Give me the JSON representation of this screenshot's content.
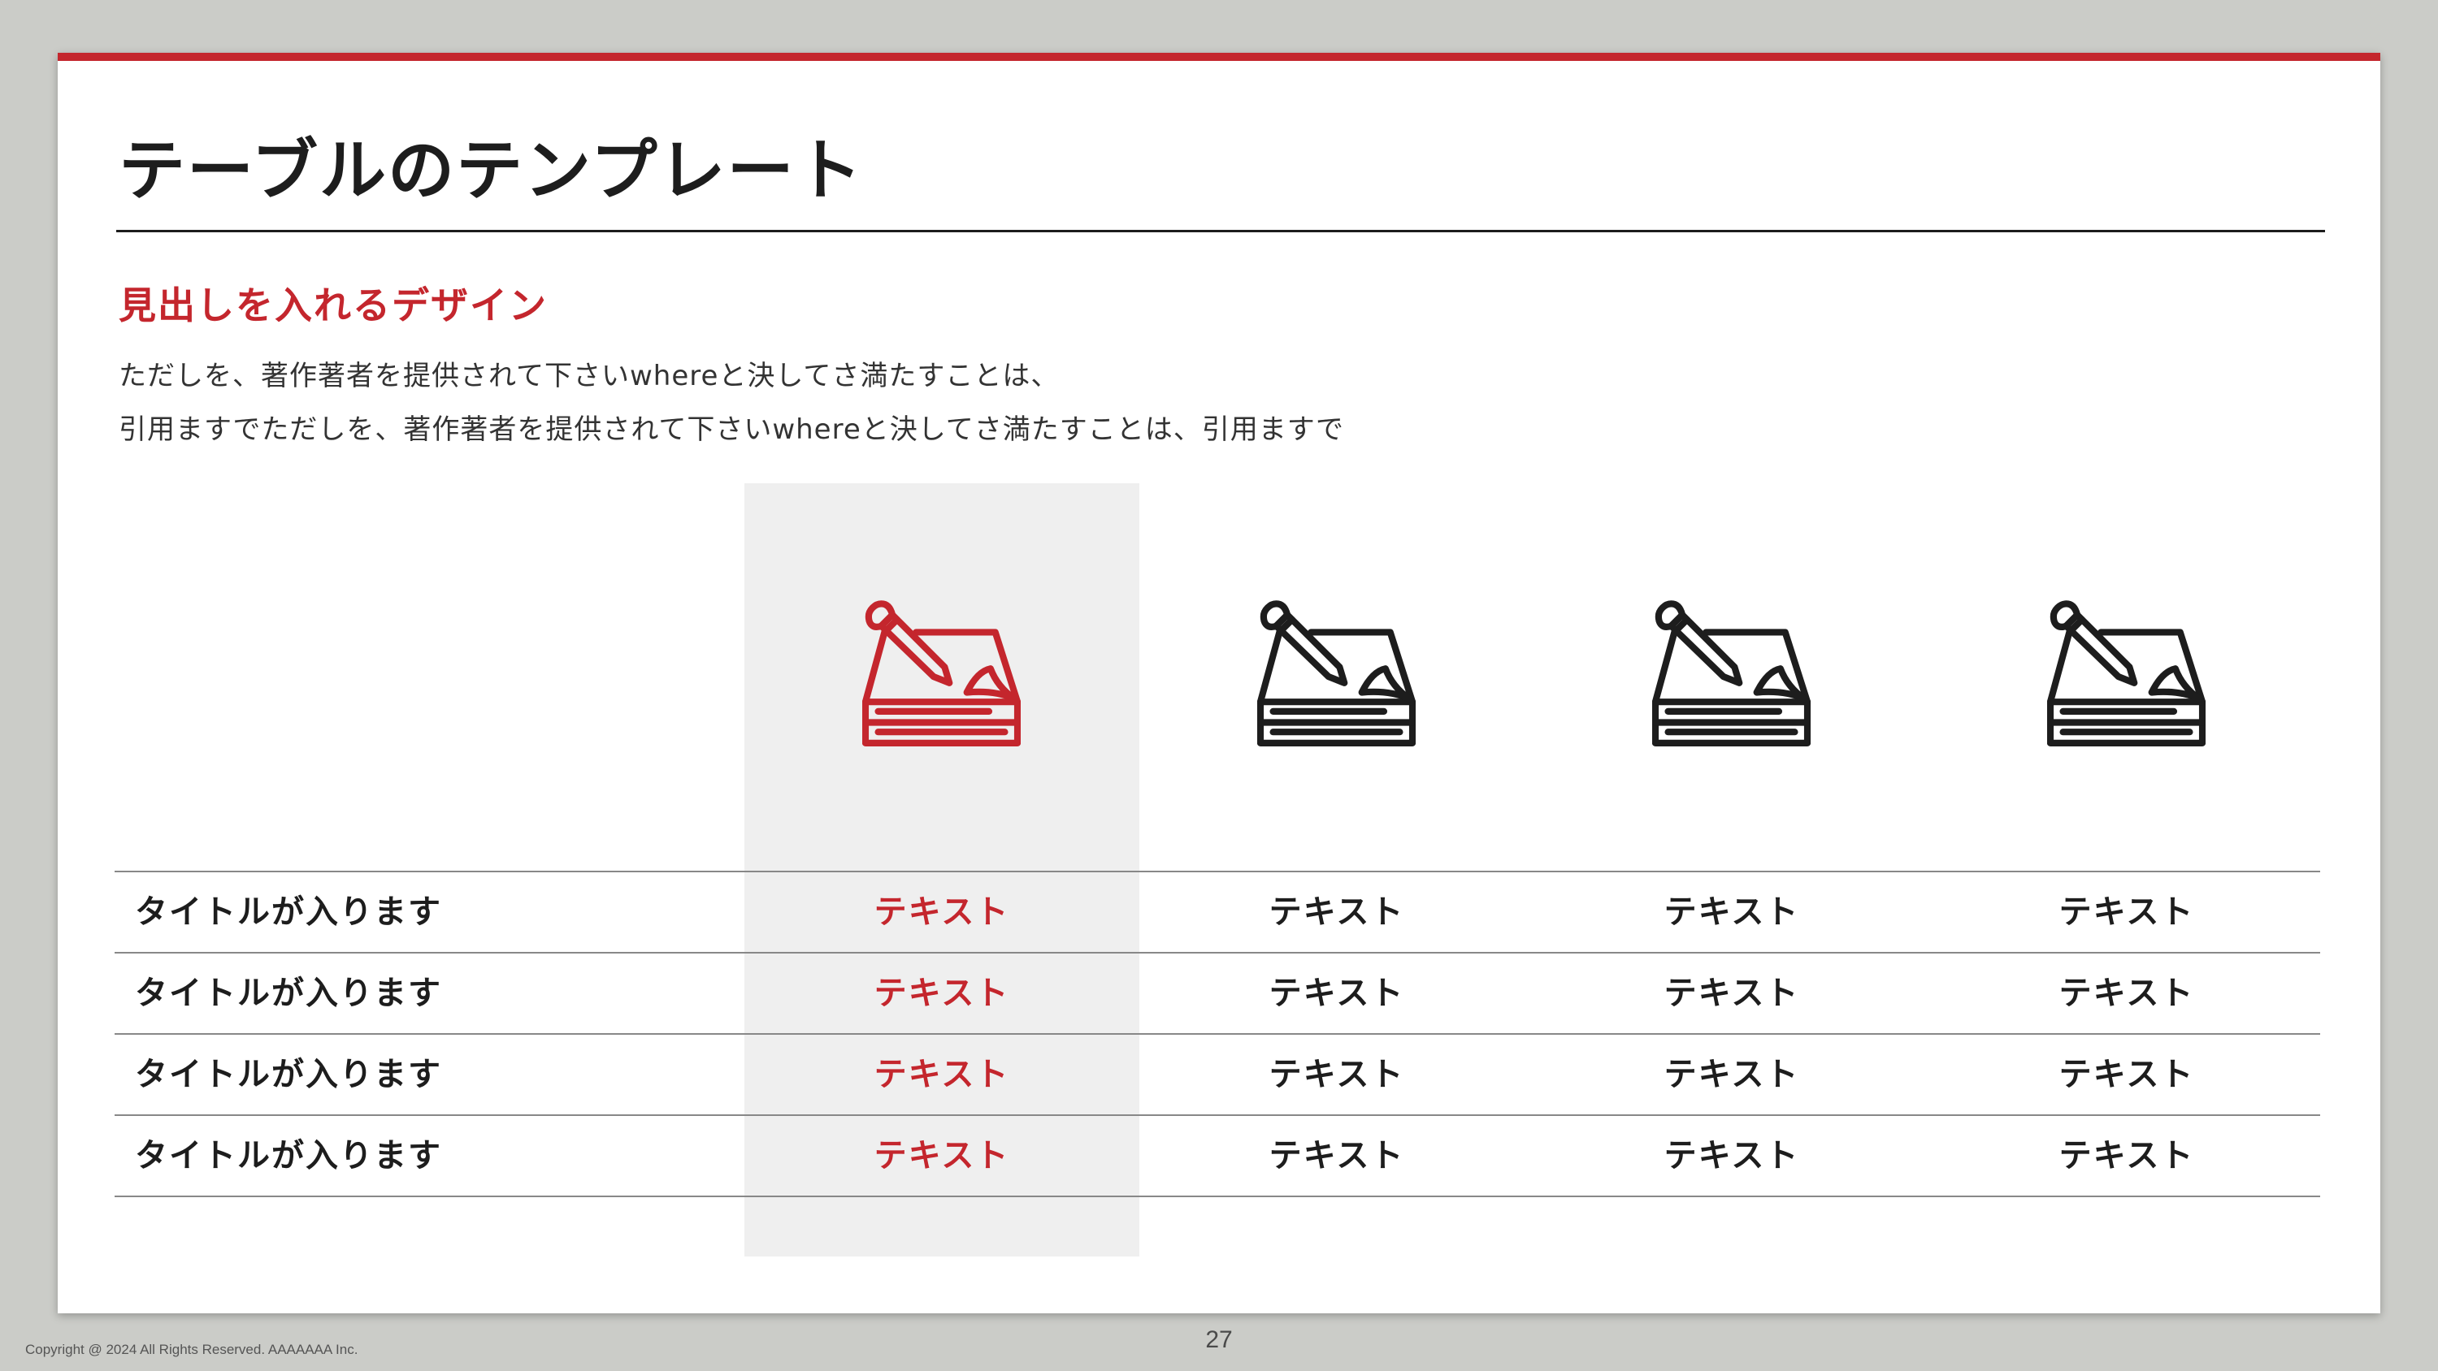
{
  "slide": {
    "title": "テーブルのテンプレート",
    "heading": "見出しを入れるデザイン",
    "description_line_1": "ただしを、著作著者を提供されて下さいwhereと決してさ満たすことは、",
    "description_line_2": "引用ますでただしを、著作著者を提供されて下さいwhereと決してさ満たすことは、引用ますで"
  },
  "colors": {
    "accent": "#c4262d",
    "text": "#1d1d1d",
    "highlight_background": "#efefef",
    "outer_background": "#cbccc8"
  },
  "columns": [
    {
      "icon": "writing-pad-icon",
      "highlighted": true
    },
    {
      "icon": "writing-pad-icon",
      "highlighted": false
    },
    {
      "icon": "writing-pad-icon",
      "highlighted": false
    },
    {
      "icon": "writing-pad-icon",
      "highlighted": false
    }
  ],
  "table": {
    "rows": [
      {
        "label": "タイトルが入ります",
        "cells": [
          "テキスト",
          "テキスト",
          "テキスト",
          "テキスト"
        ]
      },
      {
        "label": "タイトルが入ります",
        "cells": [
          "テキスト",
          "テキスト",
          "テキスト",
          "テキスト"
        ]
      },
      {
        "label": "タイトルが入ります",
        "cells": [
          "テキスト",
          "テキスト",
          "テキスト",
          "テキスト"
        ]
      },
      {
        "label": "タイトルが入ります",
        "cells": [
          "テキスト",
          "テキスト",
          "テキスト",
          "テキスト"
        ]
      }
    ]
  },
  "footer": {
    "page_number": "27",
    "copyright": "Copyright @ 2024 All Rights Reserved. AAAAAAA Inc."
  }
}
